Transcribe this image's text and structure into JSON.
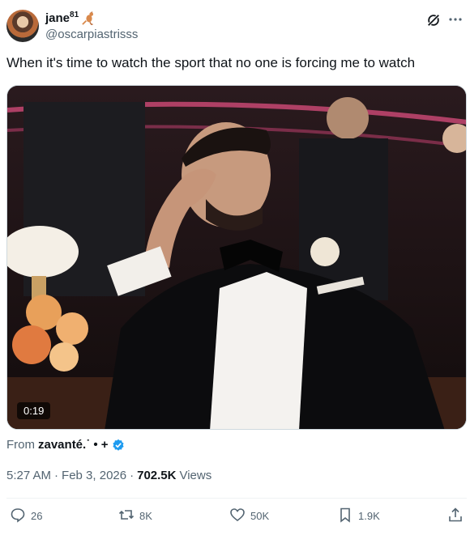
{
  "author": {
    "display_name": "jane",
    "superscript": "81",
    "emoji_icon": "kangaroo-icon",
    "handle": "@oscarpiastrisss"
  },
  "tweet": {
    "text": "When it's time to watch the sport that no one is forcing me to watch"
  },
  "media": {
    "duration": "0:19"
  },
  "attribution": {
    "prefix": "From",
    "source": "zavanté.˙ • +",
    "verified_icon": "verified-badge-icon"
  },
  "meta": {
    "time": "5:27 AM",
    "separator": "·",
    "date": "Feb 3, 2026",
    "views_count": "702.5K",
    "views_label": "Views"
  },
  "actions": {
    "replies": "26",
    "reposts": "8K",
    "likes": "50K",
    "bookmarks": "1.9K"
  },
  "colors": {
    "text_primary": "#0f1419",
    "text_secondary": "#536471",
    "verified_blue": "#1d9bf0",
    "divider": "#eff3f4"
  }
}
